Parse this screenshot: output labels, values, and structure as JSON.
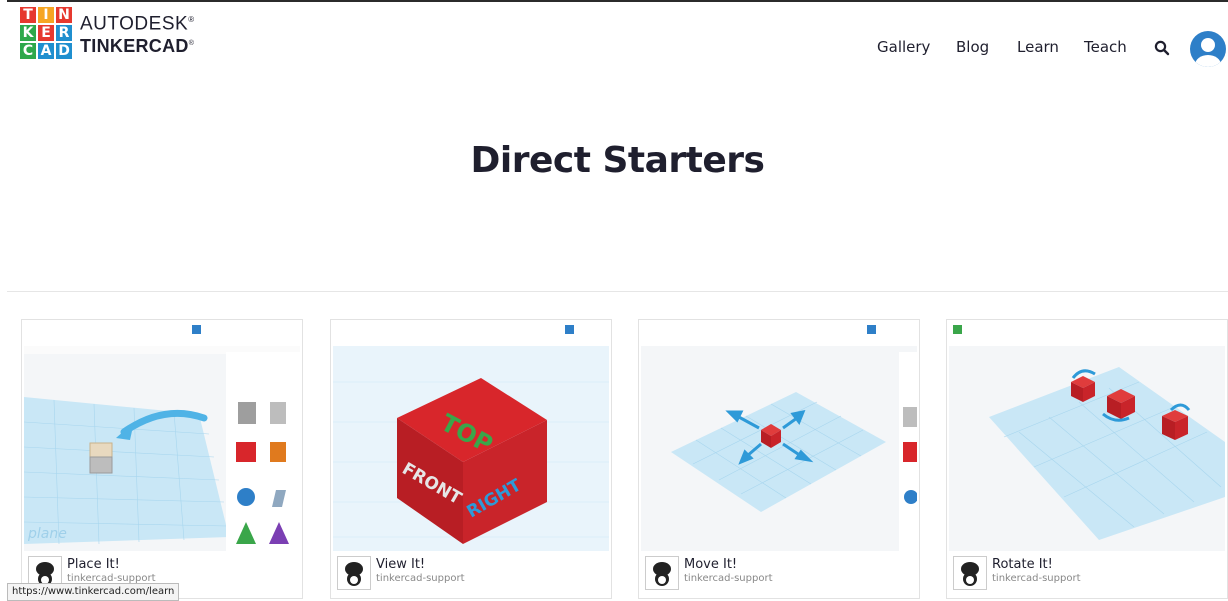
{
  "brand": {
    "logo_letters": [
      "T",
      "I",
      "N",
      "K",
      "E",
      "R",
      "C",
      "A",
      "D"
    ],
    "logo_colors": [
      "#e6392f",
      "#f6a623",
      "#e6392f",
      "#2ea84b",
      "#e6392f",
      "#1f8fcf",
      "#2ea84b",
      "#1f8fcf",
      "#1f8fcf"
    ],
    "line1": "AUTODESK",
    "line2": "TINKERCAD",
    "reg": "®"
  },
  "nav": {
    "items": [
      "Gallery",
      "Blog",
      "Learn",
      "Teach"
    ],
    "search_icon": "search-icon",
    "avatar_icon": "user-avatar-icon"
  },
  "hero": {
    "title": "Direct Starters"
  },
  "cards": [
    {
      "title": "Place It!",
      "author": "tinkercad-support"
    },
    {
      "title": "View It!",
      "author": "tinkercad-support"
    },
    {
      "title": "Move It!",
      "author": "tinkercad-support"
    },
    {
      "title": "Rotate It!",
      "author": "tinkercad-support"
    }
  ],
  "cube_labels": {
    "top": "TOP",
    "front": "FRONT",
    "right": "RIGHT"
  },
  "statusbar": {
    "url": "https://www.tinkercad.com/learn"
  },
  "colors": {
    "accent": "#2e7fc8",
    "cube_red": "#d8262b",
    "grid_blue": "#9fd3ee"
  }
}
